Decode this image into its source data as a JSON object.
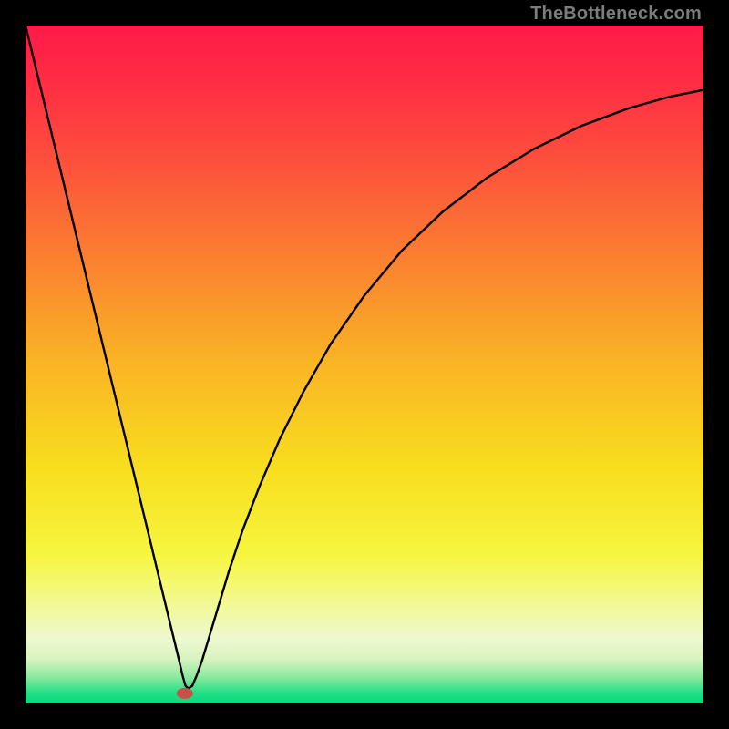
{
  "watermark": "TheBottleneck.com",
  "chart_data": {
    "type": "line",
    "title": "",
    "xlabel": "",
    "ylabel": "",
    "xlim": [
      0,
      1
    ],
    "ylim": [
      0,
      1
    ],
    "background_gradient": {
      "stops": [
        {
          "offset": 0.0,
          "color": "#ff1b49"
        },
        {
          "offset": 0.08,
          "color": "#ff2c44"
        },
        {
          "offset": 0.2,
          "color": "#fd503c"
        },
        {
          "offset": 0.35,
          "color": "#fb8230"
        },
        {
          "offset": 0.5,
          "color": "#fab525"
        },
        {
          "offset": 0.65,
          "color": "#f8dd1e"
        },
        {
          "offset": 0.78,
          "color": "#f6f63f"
        },
        {
          "offset": 0.86,
          "color": "#f2f99c"
        },
        {
          "offset": 0.905,
          "color": "#edf8cf"
        },
        {
          "offset": 0.935,
          "color": "#d7f3c0"
        },
        {
          "offset": 0.96,
          "color": "#8fe9a0"
        },
        {
          "offset": 0.985,
          "color": "#22de85"
        },
        {
          "offset": 1.0,
          "color": "#06d97d"
        }
      ]
    },
    "marker": {
      "x": 0.235,
      "y": 0.985,
      "color": "#c94f48",
      "rx": 9,
      "ry": 6
    },
    "series": [
      {
        "name": "bottleneck-curve",
        "color": "#000000",
        "width": 2.4,
        "points": [
          {
            "x": 0.0,
            "y": 0.0
          },
          {
            "x": 0.03,
            "y": 0.124
          },
          {
            "x": 0.06,
            "y": 0.248
          },
          {
            "x": 0.09,
            "y": 0.372
          },
          {
            "x": 0.12,
            "y": 0.496
          },
          {
            "x": 0.15,
            "y": 0.62
          },
          {
            "x": 0.18,
            "y": 0.744
          },
          {
            "x": 0.2,
            "y": 0.827
          },
          {
            "x": 0.215,
            "y": 0.889
          },
          {
            "x": 0.225,
            "y": 0.93
          },
          {
            "x": 0.232,
            "y": 0.96
          },
          {
            "x": 0.236,
            "y": 0.974
          },
          {
            "x": 0.24,
            "y": 0.978
          },
          {
            "x": 0.246,
            "y": 0.974
          },
          {
            "x": 0.252,
            "y": 0.96
          },
          {
            "x": 0.26,
            "y": 0.938
          },
          {
            "x": 0.27,
            "y": 0.905
          },
          {
            "x": 0.285,
            "y": 0.855
          },
          {
            "x": 0.3,
            "y": 0.805
          },
          {
            "x": 0.32,
            "y": 0.745
          },
          {
            "x": 0.345,
            "y": 0.68
          },
          {
            "x": 0.375,
            "y": 0.61
          },
          {
            "x": 0.41,
            "y": 0.54
          },
          {
            "x": 0.45,
            "y": 0.47
          },
          {
            "x": 0.5,
            "y": 0.398
          },
          {
            "x": 0.555,
            "y": 0.332
          },
          {
            "x": 0.615,
            "y": 0.275
          },
          {
            "x": 0.68,
            "y": 0.225
          },
          {
            "x": 0.75,
            "y": 0.182
          },
          {
            "x": 0.82,
            "y": 0.148
          },
          {
            "x": 0.89,
            "y": 0.122
          },
          {
            "x": 0.95,
            "y": 0.105
          },
          {
            "x": 1.0,
            "y": 0.095
          }
        ]
      }
    ]
  }
}
